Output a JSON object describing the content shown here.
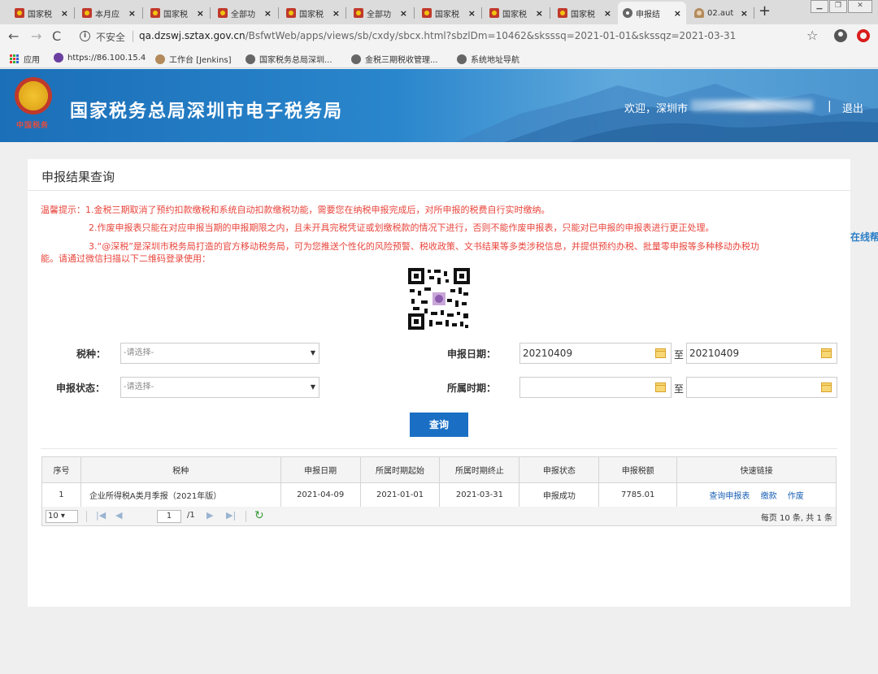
{
  "browser": {
    "tabs": [
      {
        "title": "国家税",
        "icon": "tax-emblem-icon"
      },
      {
        "title": "本月应",
        "icon": "tax-emblem-icon"
      },
      {
        "title": "国家税",
        "icon": "tax-emblem-icon"
      },
      {
        "title": "全部功",
        "icon": "tax-emblem-icon"
      },
      {
        "title": "国家税",
        "icon": "tax-emblem-icon"
      },
      {
        "title": "全部功",
        "icon": "tax-emblem-icon"
      },
      {
        "title": "国家税",
        "icon": "tax-emblem-icon"
      },
      {
        "title": "国家税",
        "icon": "tax-emblem-icon"
      },
      {
        "title": "国家税",
        "icon": "tax-emblem-icon"
      },
      {
        "title": "申报结",
        "icon": "globe-icon"
      },
      {
        "title": "02.aut",
        "icon": "person-icon"
      }
    ],
    "tab_close": "×",
    "new_tab": "+",
    "insecure_label": "不安全",
    "url_host": "qa.dzswj.sztax.gov.cn",
    "url_path": "/BsfwtWeb/apps/views/sb/cxdy/sbcx.html?sbzlDm=10462&sksssq=2021-01-01&skssqz=2021-03-31",
    "bookmarks": [
      {
        "label": "应用",
        "icon": "apps-icon"
      },
      {
        "label": "https://86.100.15.4",
        "icon": "purple-globe-icon"
      },
      {
        "label": "工作台 [Jenkins]",
        "icon": "jenkins-icon"
      },
      {
        "label": "国家税务总局深圳...",
        "icon": "globe-icon"
      },
      {
        "label": "金税三期税收管理...",
        "icon": "globe-icon"
      },
      {
        "label": "系统地址导航",
        "icon": "globe-icon"
      }
    ]
  },
  "header": {
    "emblem_caption": "中国税务",
    "site_title": "国家税务总局深圳市电子税务局",
    "welcome": "欢迎，深圳市",
    "separator": "|",
    "logout": "退出"
  },
  "panel": {
    "title": "申报结果查询",
    "notices": [
      "温馨提示：1.金税三期取消了预约扣款缴税和系统自动扣款缴税功能，需要您在纳税申报完成后，对所申报的税费自行实时缴纳。",
      "2.作废申报表只能在对应申报当期的申报期限之内，且未开具完税凭证或划缴税款的情况下进行，否则不能作废申报表，只能对已申报的申报表进行更正处理。",
      "3.“@深税”是深圳市税务局打造的官方移动税务局，可为您推送个性化的风险预警、税收政策、文书结果等多类涉税信息，并提供预约办税、批量零申报等多种移动办税功",
      "能。请通过微信扫描以下二维码登录使用："
    ]
  },
  "form": {
    "tax_type_label": "税种：",
    "tax_type_placeholder": "-请选择-",
    "status_label": "申报状态：",
    "status_placeholder": "-请选择-",
    "date_label": "申报日期：",
    "date_from": "20210409",
    "date_to": "20210409",
    "period_label": "所属时期：",
    "period_from": "",
    "period_to": "",
    "to_text": "至",
    "query_button": "查询"
  },
  "table": {
    "columns": [
      "序号",
      "税种",
      "申报日期",
      "所属时期起始",
      "所属时期终止",
      "申报状态",
      "申报税额",
      "快速链接"
    ],
    "rows": [
      {
        "index": "1",
        "tax_type": "企业所得税A类月季报（2021年版）",
        "declare_date": "2021-04-09",
        "period_start": "2021-01-01",
        "period_end": "2021-03-31",
        "status": "申报成功",
        "amount": "7785.01",
        "links": [
          "查询申报表",
          "缴款",
          "作废"
        ]
      }
    ]
  },
  "pager": {
    "page_size": "10",
    "current_page": "1",
    "total_pages": "/1",
    "summary": "每页 10 条, 共 1 条"
  },
  "side_help": "在线帮"
}
